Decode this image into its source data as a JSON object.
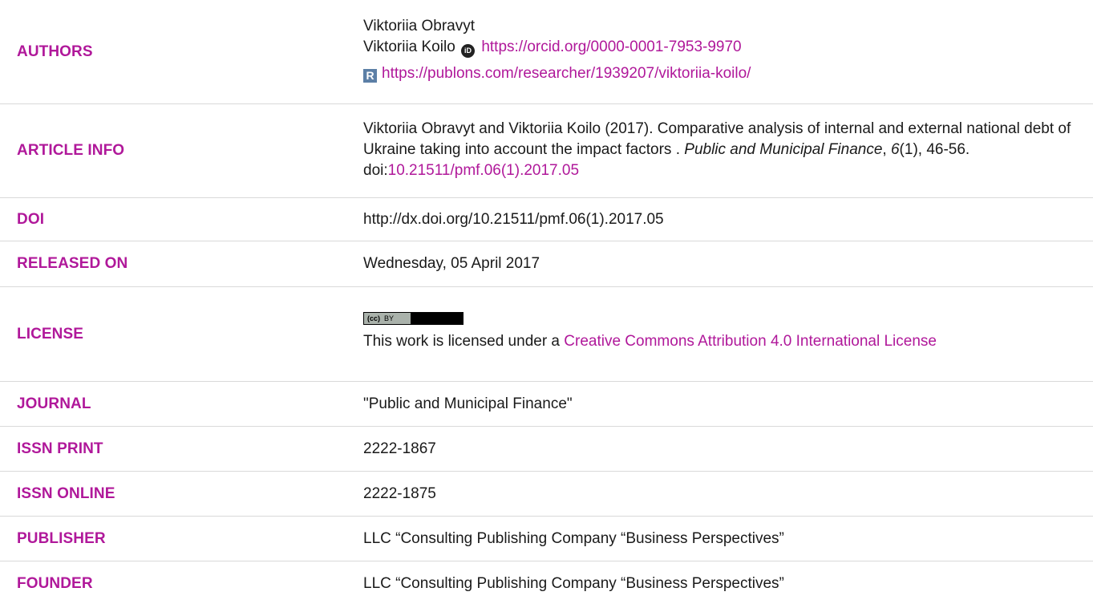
{
  "authors": {
    "label": "AUTHORS",
    "author1": "Viktoriia Obravyt",
    "author2": "Viktoriia Koilo",
    "orcid_url": "https://orcid.org/0000-0001-7953-9970",
    "publons_url": "https://publons.com/researcher/1939207/viktoriia-koilo/"
  },
  "article_info": {
    "label": "ARTICLE INFO",
    "citation_prefix": "Viktoriia Obravyt and Viktoriia Koilo (2017). Comparative analysis of internal and external national debt of Ukraine taking into account the impact factors . ",
    "journal_italic": "Public and Municipal Finance",
    "sep1": ", ",
    "volume_italic": "6",
    "issue_pages": "(1), 46-56. doi:",
    "doi_link": "10.21511/pmf.06(1).2017.05"
  },
  "doi": {
    "label": "DOI",
    "value": "http://dx.doi.org/10.21511/pmf.06(1).2017.05"
  },
  "released": {
    "label": "RELEASED ON",
    "value": "Wednesday, 05 April 2017"
  },
  "license": {
    "label": "LICENSE",
    "badge_cc": "(cc)",
    "badge_by": "BY",
    "text_prefix": "This work is licensed under a ",
    "link_text": "Creative Commons Attribution 4.0 International License"
  },
  "journal": {
    "label": "JOURNAL",
    "value": "\"Public and Municipal Finance\""
  },
  "issn_print": {
    "label": "ISSN PRINT",
    "value": "2222-1867"
  },
  "issn_online": {
    "label": "ISSN ONLINE",
    "value": "2222-1875"
  },
  "publisher": {
    "label": "PUBLISHER",
    "value": "LLC “Consulting Publishing Company “Business Perspectives”"
  },
  "founder": {
    "label": "FOUNDER",
    "value": "LLC “Consulting Publishing Company “Business Perspectives”"
  },
  "icons": {
    "orcid": "orcid-icon",
    "publons": "publons-icon",
    "cc": "cc-by-badge"
  },
  "colors": {
    "accent": "#b0189a",
    "divider": "#d9d9d9",
    "text": "#1a1a1a"
  }
}
